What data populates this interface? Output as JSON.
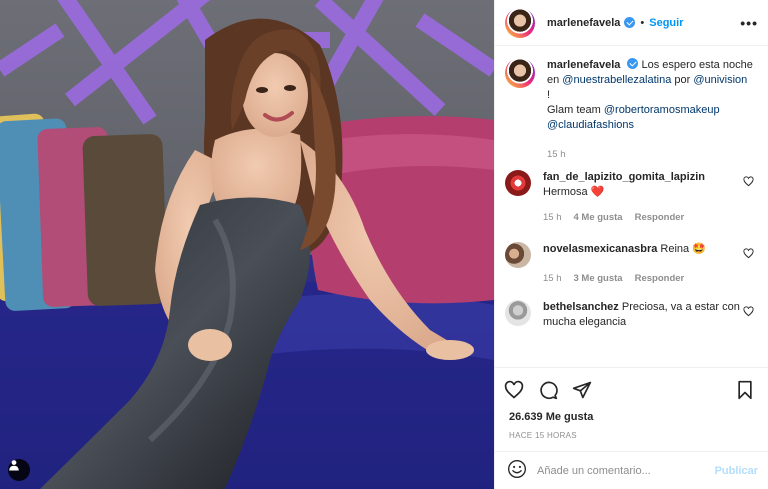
{
  "header": {
    "username": "marlenefavela",
    "separator": "•",
    "follow_label": "Seguir",
    "more_icon": "more-horizontal-icon"
  },
  "caption": {
    "username": "marlenefavela",
    "text_1": "Los espero esta noche en ",
    "mention_1": "@nuestrabellezalatina",
    "text_2": " por ",
    "mention_2": "@univision",
    "text_3": " !",
    "text_4": "Glam team ",
    "mention_3": "@robertoramosmakeup",
    "mention_4": "@claudiafashions",
    "time": "15 h"
  },
  "comments": [
    {
      "username": "fan_de_lapizito_gomita_lapizin",
      "text": "Hermosa ",
      "emoji": "❤️",
      "time": "15 h",
      "likes": "4 Me gusta",
      "reply": "Responder"
    },
    {
      "username": "novelasmexicanasbra",
      "text": "Reina",
      "emoji": "🤩",
      "time": "15 h",
      "likes": "3 Me gusta",
      "reply": "Responder"
    },
    {
      "username": "bethelsanchez",
      "text": "Preciosa, va a estar con mucha elegancia",
      "emoji": ""
    }
  ],
  "actions": {
    "like_icon": "heart-icon",
    "comment_icon": "comment-icon",
    "share_icon": "share-icon",
    "save_icon": "bookmark-icon"
  },
  "likes_count": "26.639 Me gusta",
  "post_age": "HACE 15 HORAS",
  "add_comment": {
    "placeholder": "Añade un comentario...",
    "publish_label": "Publicar"
  },
  "colors": {
    "accent": "#0095f6",
    "verified": "#3897f0",
    "publish_disabled": "#b2dffc",
    "muted_text": "#8e8e8e",
    "mention": "#00376b"
  }
}
